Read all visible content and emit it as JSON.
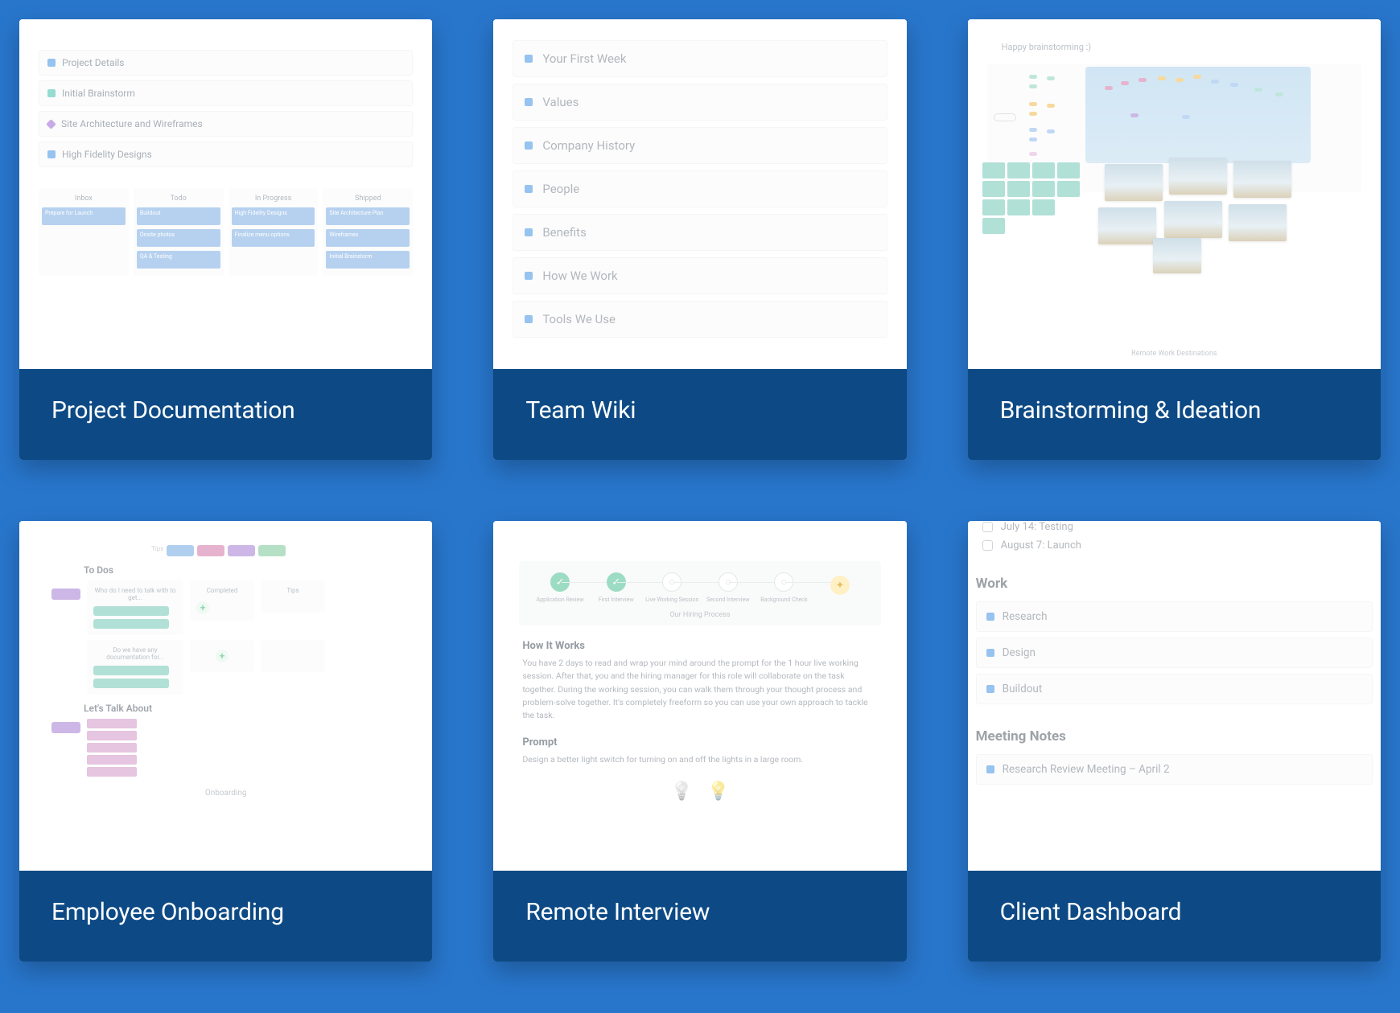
{
  "cards": {
    "project_documentation": {
      "title": "Project Documentation",
      "items": [
        "Project Details",
        "Initial Brainstorm",
        "Site Architecture and Wireframes",
        "High Fidelity Designs"
      ],
      "kanban": {
        "columns": [
          "Inbox",
          "Todo",
          "In Progress",
          "Shipped"
        ],
        "cards": {
          "Inbox": [
            "Prepare for Launch"
          ],
          "Todo": [
            "Buildout",
            "Onsite photos",
            "QA & Testing"
          ],
          "In Progress": [
            "High Fidelity Designs",
            "Finalize menu options"
          ],
          "Shipped": [
            "Site Architecture Plan",
            "Wireframes",
            "Initial Brainstorm"
          ]
        }
      }
    },
    "team_wiki": {
      "title": "Team Wiki",
      "items": [
        "Your First Week",
        "Values",
        "Company History",
        "People",
        "Benefits",
        "How We Work",
        "Tools We Use"
      ]
    },
    "brainstorming": {
      "title": "Brainstorming & Ideation",
      "heading": "Happy brainstorming :)",
      "caption": "Remote Work Destinations"
    },
    "employee_onboarding": {
      "title": "Employee Onboarding",
      "sections": {
        "todos": "To Dos",
        "talk": "Let's Talk About"
      },
      "lane_titles": [
        "Who do I need to talk with to get...",
        "Completed",
        "Tips"
      ],
      "lane2_title": "Do we have any documentation for...",
      "caption": "Onboarding"
    },
    "remote_interview": {
      "title": "Remote Interview",
      "steps": [
        "Application Review",
        "First Interview",
        "Live Working Session",
        "Second Interview",
        "Background Check",
        ""
      ],
      "process_caption": "Our Hiring Process",
      "h1": "How It Works",
      "p1": "You have 2 days to read and wrap your mind around the prompt for the 1 hour live working session. After that, you and the hiring manager for this role will collaborate on the task together. During the working session, you can walk them through your thought process and problem-solve together. It's completely freeform so you can use your own approach to tackle the task.",
      "h2": "Prompt",
      "p2": "Design a better light switch for turning on and off the lights in a large room."
    },
    "client_dashboard": {
      "title": "Client Dashboard",
      "checks": [
        "July 14: Testing",
        "August 7: Launch"
      ],
      "work_h": "Work",
      "work_items": [
        "Research",
        "Design",
        "Buildout"
      ],
      "notes_h": "Meeting Notes",
      "notes_items": [
        "Research Review Meeting – April 2"
      ]
    }
  }
}
